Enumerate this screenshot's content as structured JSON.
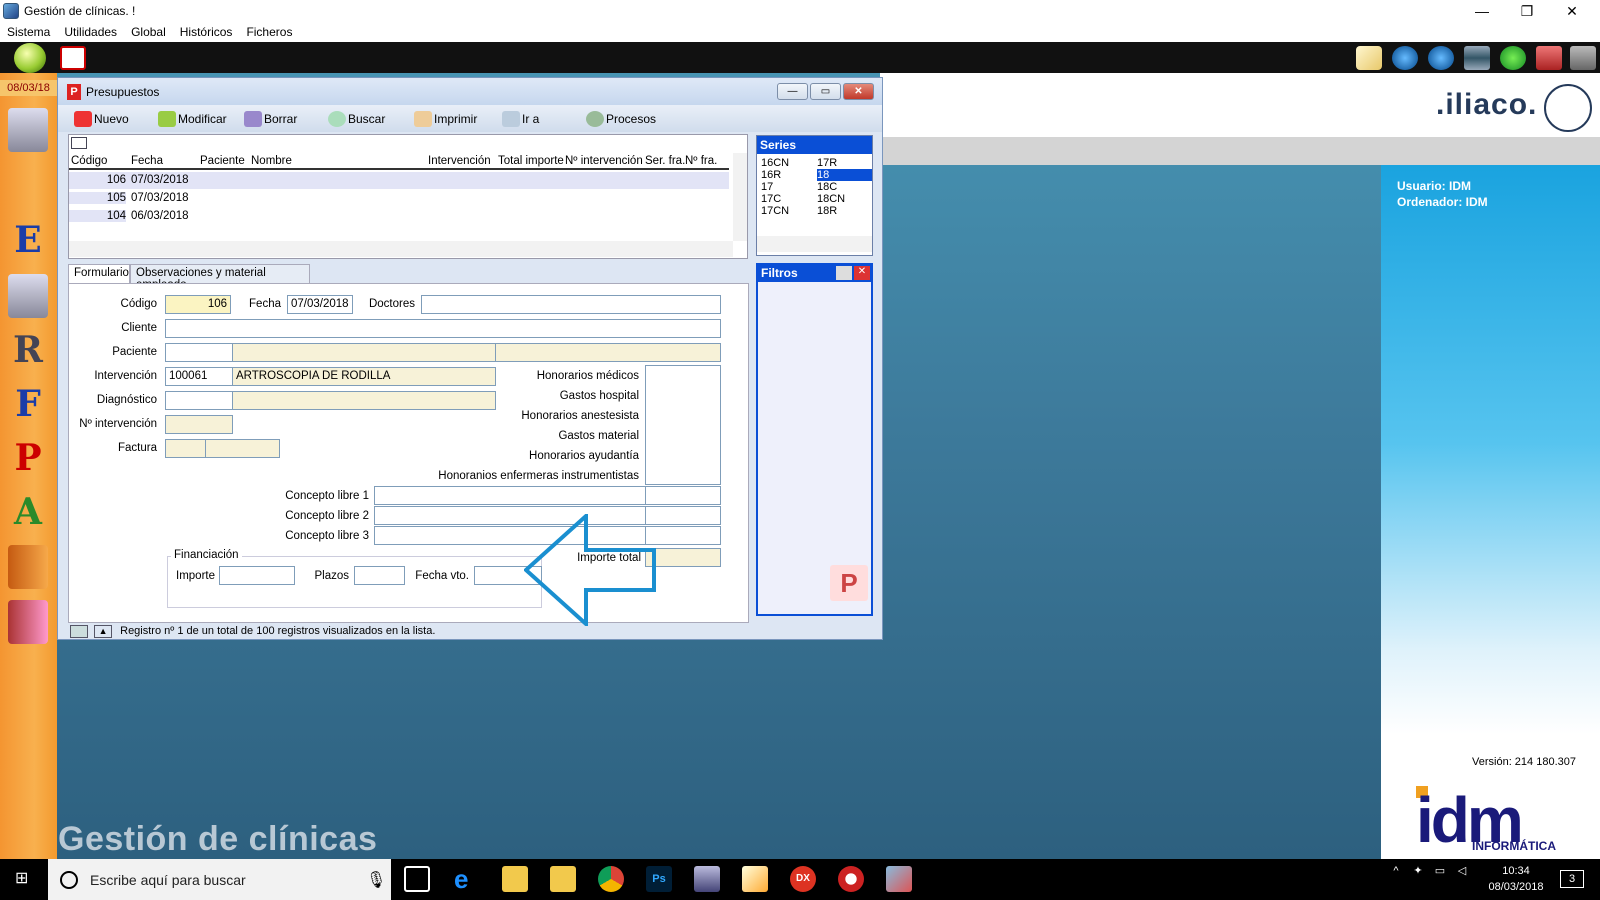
{
  "window": {
    "title": "Gestión de clínicas. !",
    "minimize": "—",
    "restore": "❐",
    "close": "✕"
  },
  "menu": [
    "Sistema",
    "Utilidades",
    "Global",
    "Históricos",
    "Ficheros"
  ],
  "sidebar": {
    "date": "08/03/18",
    "letters": [
      "E",
      "R",
      "F",
      "P",
      "A"
    ]
  },
  "branding": {
    "iliaco": ".iliaco.",
    "user_label": "Usuario: IDM",
    "computer_label": "Ordenador: IDM",
    "version": "Versión: 214 180.307",
    "idm": "idm",
    "idm_sub": "INFORMÁTICA",
    "app_name": "Gestión de clínicas"
  },
  "dialog": {
    "title": "Presupuestos",
    "toolbar": [
      "Nuevo",
      "Modificar",
      "Borrar",
      "Buscar",
      "Imprimir",
      "Ir a",
      "Procesos"
    ],
    "grid": {
      "columns": [
        "Código",
        "Fecha",
        "Paciente",
        "Nombre",
        "Intervención",
        "Total importe",
        "Nº intervención",
        "Ser. fra.",
        "Nº fra."
      ],
      "rows": [
        {
          "codigo": "106",
          "fecha": "07/03/2018"
        },
        {
          "codigo": "105",
          "fecha": "07/03/2018"
        },
        {
          "codigo": "104",
          "fecha": "06/03/2018"
        }
      ]
    },
    "series": {
      "title": "Series",
      "col1": [
        "16CN",
        "16R",
        "17",
        "17C",
        "17CN"
      ],
      "col2": [
        "17R",
        "18",
        "18C",
        "18CN",
        "18R"
      ],
      "selected": "18"
    },
    "filtros": {
      "title": "Filtros"
    },
    "tabs": [
      "Formulario",
      "Observaciones y material empleado"
    ],
    "form": {
      "codigo_label": "Código",
      "codigo": "106",
      "fecha_label": "Fecha",
      "fecha": "07/03/2018",
      "doctores_label": "Doctores",
      "cliente_label": "Cliente",
      "paciente_label": "Paciente",
      "intervencion_label": "Intervención",
      "intervencion_code": "100061",
      "intervencion_name": "ARTROSCOPIA DE RODILLA",
      "diagnostico_label": "Diagnóstico",
      "nint_label": "Nº intervención",
      "factura_label": "Factura",
      "honorarios": [
        "Honorarios médicos",
        "Gastos hospital",
        "Honorarios anestesista",
        "Gastos material",
        "Honorarios ayudantía",
        "Honoranios enfermeras instrumentistas"
      ],
      "conceptos": [
        "Concepto libre 1",
        "Concepto libre 2",
        "Concepto libre 3"
      ],
      "financiacion_label": "Financiación",
      "importe_label": "Importe",
      "plazos_label": "Plazos",
      "fecha_vto_label": "Fecha vto.",
      "importe_total_label": "Importe total"
    },
    "status": "Registro nº 1 de un total de 100 registros visualizados en la lista."
  },
  "taskbar": {
    "search_placeholder": "Escribe aquí para buscar",
    "time": "10:34",
    "date": "08/03/2018",
    "notifications": "3"
  },
  "colors": {
    "accent_blue": "#0a4fd6",
    "arrow": "#1a8fd0",
    "sidebar_orange": "#f49531"
  }
}
